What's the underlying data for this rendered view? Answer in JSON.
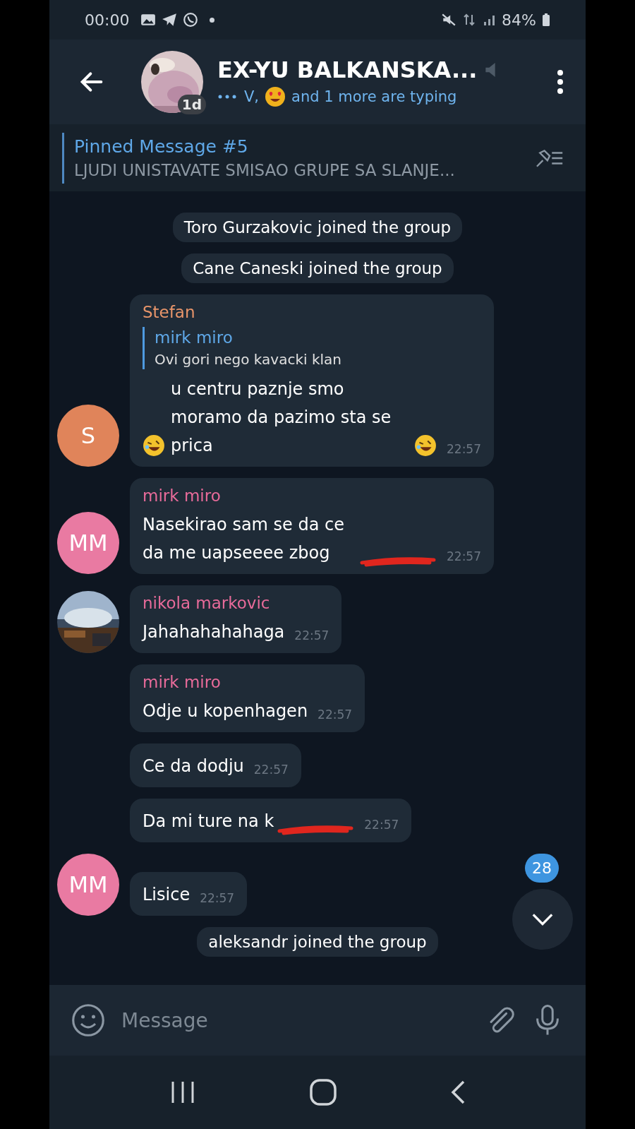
{
  "status_bar": {
    "time": "00:00",
    "battery": "84%"
  },
  "header": {
    "title": "EX-YU BALKANSKA...",
    "avatar_badge": "1d",
    "typing_prefix": "V,",
    "typing_suffix": "and 1 more are typing",
    "muted": true
  },
  "pinned": {
    "title": "Pinned Message #5",
    "text": "LJUDI UNISTAVATE SMISAO GRUPE SA SLANJE..."
  },
  "messages": [
    {
      "kind": "system",
      "text": "Toro Gurzakovic joined the group"
    },
    {
      "kind": "system",
      "text": "Cane Caneski joined the group"
    },
    {
      "kind": "message",
      "sender": {
        "name": "Stefan",
        "color": "#e8956a"
      },
      "avatar": {
        "kind": "initials",
        "initials": "S",
        "color": "#e0845a"
      },
      "reply": {
        "sender": "mirk miro",
        "text": "Ovi gori nego kavacki klan"
      },
      "segments": [
        {
          "kind": "emoji"
        },
        {
          "kind": "text",
          "text": "u centru paznje smo moramo da pazimo sta se prica"
        },
        {
          "kind": "emoji"
        }
      ],
      "time": "22:57",
      "redacted": false
    },
    {
      "kind": "message",
      "sender": {
        "name": "mirk miro",
        "color": "#e86b9a"
      },
      "avatar": {
        "kind": "initials",
        "initials": "MM",
        "color": "#e97aa2"
      },
      "segments": [
        {
          "kind": "text",
          "text": "Nasekirao sam se da ce da me uapseeee zbog"
        }
      ],
      "time": "22:57",
      "redacted": true
    },
    {
      "kind": "message",
      "sender": {
        "name": "nikola markovic",
        "color": "#e86b9a"
      },
      "segments": [
        {
          "kind": "text",
          "text": "Jahahahahahaga"
        }
      ],
      "time": "22:57",
      "redacted": false
    },
    {
      "kind": "message",
      "sender": {
        "name": "mirk miro",
        "color": "#e86b9a"
      },
      "segments": [
        {
          "kind": "text",
          "text": "Odje u kopenhagen"
        }
      ],
      "time": "22:57",
      "redacted": false
    },
    {
      "kind": "message",
      "segments": [
        {
          "kind": "text",
          "text": "Ce da dodju"
        }
      ],
      "time": "22:57",
      "redacted": false
    },
    {
      "kind": "message",
      "segments": [
        {
          "kind": "text",
          "text": "Da mi ture na k"
        }
      ],
      "time": "22:57",
      "redacted": true
    },
    {
      "kind": "message",
      "avatar": {
        "kind": "initials",
        "initials": "MM",
        "color": "#e97aa2"
      },
      "segments": [
        {
          "kind": "text",
          "text": "Lisice"
        }
      ],
      "time": "22:57",
      "redacted": false
    },
    {
      "kind": "system",
      "text": "aleksandr joined the group"
    }
  ],
  "unread_badge": "28",
  "composer": {
    "placeholder": "Message"
  }
}
